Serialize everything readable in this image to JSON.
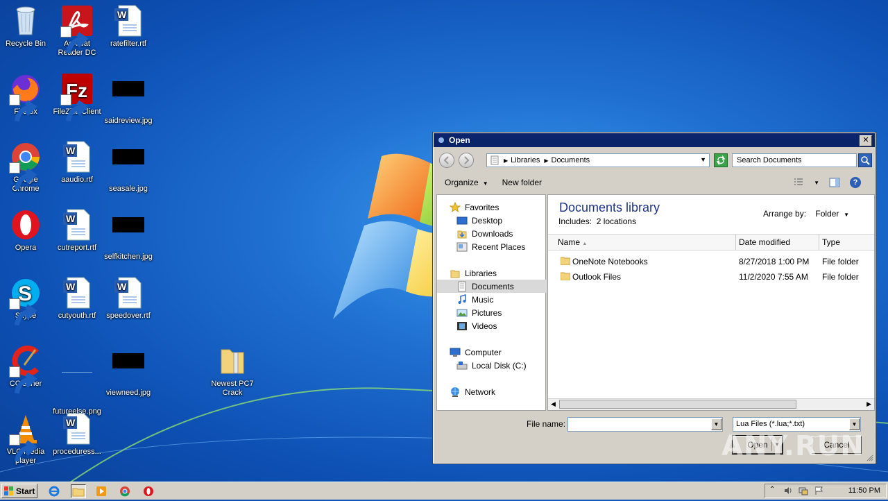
{
  "desktop": {
    "icons": [
      {
        "label": "Recycle Bin"
      },
      {
        "label": "Acrobat Reader DC"
      },
      {
        "label": "ratefilter.rtf"
      },
      {
        "label": "Firefox"
      },
      {
        "label": "FileZilla Client"
      },
      {
        "label": "saidreview.jpg"
      },
      {
        "label": "Google Chrome"
      },
      {
        "label": "aaudio.rtf"
      },
      {
        "label": "seasale.jpg"
      },
      {
        "label": "Opera"
      },
      {
        "label": "cutreport.rtf"
      },
      {
        "label": "selfkitchen.jpg"
      },
      {
        "label": "Skype"
      },
      {
        "label": "cutyouth.rtf"
      },
      {
        "label": "speedover.rtf"
      },
      {
        "label": "CCleaner"
      },
      {
        "label": "futureelse.png"
      },
      {
        "label": "viewneed.jpg"
      },
      {
        "label": "VLC media player"
      },
      {
        "label": "proceduress..."
      },
      {
        "label": "Newest PC7 Crack"
      }
    ]
  },
  "dialog": {
    "title": "Open",
    "address": {
      "seg1": "Libraries",
      "seg2": "Documents"
    },
    "search_placeholder": "Search Documents",
    "toolbar": {
      "organize": "Organize",
      "new_folder": "New folder"
    },
    "nav": {
      "favorites": "Favorites",
      "desktop": "Desktop",
      "downloads": "Downloads",
      "recent_places": "Recent Places",
      "libraries": "Libraries",
      "documents": "Documents",
      "music": "Music",
      "pictures": "Pictures",
      "videos": "Videos",
      "computer": "Computer",
      "local_disk": "Local Disk (C:)",
      "network": "Network"
    },
    "library": {
      "title": "Documents library",
      "includes_label": "Includes:",
      "includes_value": "2 locations",
      "arrange_label": "Arrange by:",
      "arrange_value": "Folder"
    },
    "columns": {
      "name": "Name",
      "date": "Date modified",
      "type": "Type"
    },
    "files": [
      {
        "name": "OneNote Notebooks",
        "date": "8/27/2018 1:00 PM",
        "type": "File folder"
      },
      {
        "name": "Outlook Files",
        "date": "11/2/2020 7:55 AM",
        "type": "File folder"
      }
    ],
    "file_name_label": "File name:",
    "file_name_value": "",
    "file_type": "Lua Files (*.lua;*.txt)",
    "open_button": "Open",
    "cancel_button": "Cancel"
  },
  "watermark": "ANY.RUN",
  "taskbar": {
    "start_label": "Start",
    "clock": "11:50 PM"
  }
}
